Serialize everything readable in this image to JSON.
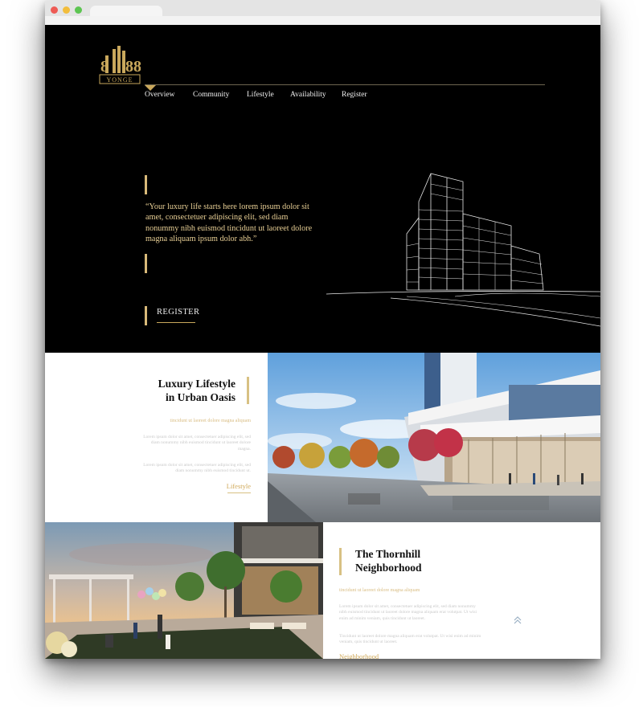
{
  "brand": {
    "logo_numbers": "8188",
    "logo_text": "YONGE",
    "accent_color": "#d8b979"
  },
  "nav": {
    "items": [
      "Overview",
      "Community",
      "Lifestyle",
      "Availability",
      "Register"
    ],
    "active": "Overview"
  },
  "hero": {
    "quote": "“Your luxury life starts here lorem ipsum dolor sit amet, consectetuer adipiscing elit, sed diam nonummy nibh euismod tincidunt ut laoreet dolore magna aliquam ipsum dolor abh.”",
    "cta_label": "REGISTER",
    "illustration": "building-wireframe-icon"
  },
  "lifestyle": {
    "title_line1": "Luxury Lifestyle",
    "title_line2": "in Urban Oasis",
    "subtitle": "tincidunt ut laoreet dolore magna aliquam",
    "para1": "Lorem ipsum dolor sit amet, consectetuer adipiscing elit, sed diam nonummy nibh euismod tincidunt ut laoreet dolore magna.",
    "para2": "Lorem ipsum dolor sit amet, consectetuer adipiscing elit, sed diam nonummy nibh euismod tincidunt ut.",
    "link_label": "Lifestyle",
    "image": "street-rendering-image"
  },
  "neighborhood": {
    "title_line1": "The Thornhill",
    "title_line2": "Neighborhood",
    "subtitle": "tincidunt ut laoreet dolore magna aliquam",
    "para1": "Lorem ipsum dolor sit amet, consectetuer adipiscing elit, sed diam nonummy nibh euismod tincidunt ut laoreet dolore magna aliquam erat volutpat. Ut wisi enim ad minim veniam, quis tincidunt ut laoreet.",
    "para2": "Tincidunt ut laoreet dolore magna aliquam erat volutpat. Ut wisi enim ad minim veniam, quis tincidunt ut laoreet.",
    "link_label": "Neighborhood",
    "image": "rooftop-terrace-image"
  },
  "scroll_top_icon": "chevron-double-up-icon"
}
